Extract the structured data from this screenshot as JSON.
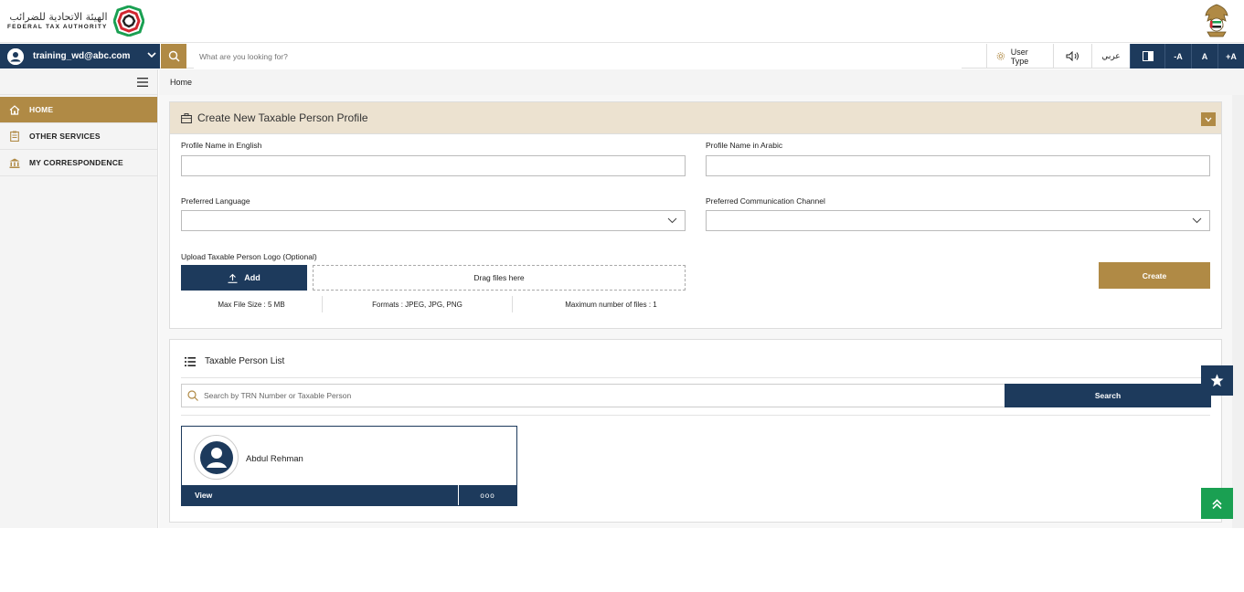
{
  "header": {
    "logo_arabic": "الهيئة الاتحادية للضرائب",
    "logo_english": "FEDERAL TAX AUTHORITY"
  },
  "navbar": {
    "user_email": "training_wd@abc.com",
    "search_placeholder": "What are you looking for?",
    "user_type_label": "User Type",
    "arabic_label": "عربي",
    "font_decrease": "-A",
    "font_reset": "A",
    "font_increase": "+A"
  },
  "sidebar": {
    "items": [
      {
        "label": "HOME",
        "icon": "home-icon",
        "active": true
      },
      {
        "label": "OTHER SERVICES",
        "icon": "clipboard-icon",
        "active": false
      },
      {
        "label": "MY CORRESPONDENCE",
        "icon": "bank-icon",
        "active": false
      }
    ]
  },
  "breadcrumb": "Home",
  "profile_form": {
    "title": "Create New Taxable Person Profile",
    "name_english_label": "Profile Name in English",
    "name_english_value": "",
    "name_arabic_label": "Profile Name in Arabic",
    "name_arabic_value": "",
    "language_label": "Preferred Language",
    "language_value": "",
    "channel_label": "Preferred Communication Channel",
    "channel_value": "",
    "upload_label": "Upload Taxable Person Logo (Optional)",
    "add_label": "Add",
    "drop_label": "Drag files here",
    "max_size": "Max File Size : 5 MB",
    "formats": "Formats : JPEG, JPG, PNG",
    "max_files": "Maximum number of files : 1",
    "create_label": "Create"
  },
  "person_list": {
    "title": "Taxable Person List",
    "search_placeholder": "Search by TRN Number or Taxable Person",
    "search_label": "Search",
    "cards": [
      {
        "name": "Abdul Rehman",
        "view_label": "View",
        "more_label": "ooo"
      }
    ]
  },
  "colors": {
    "navy": "#1d3a5c",
    "gold": "#b08a45",
    "beige": "#ece2d0",
    "green": "#1aa052"
  }
}
